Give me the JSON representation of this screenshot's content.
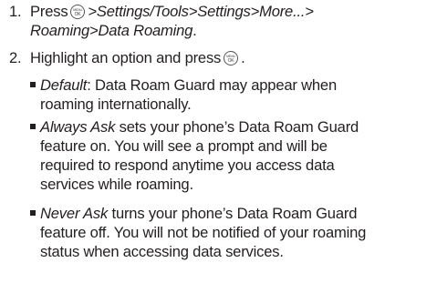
{
  "steps": [
    {
      "number": "1.",
      "prefix": "Press",
      "path_part1": ">Settings/Tools>Settings>More...>",
      "path_part2": "Roaming>Data Roaming",
      "suffix": "."
    },
    {
      "number": "2.",
      "text": "Highlight an option and press",
      "suffix": "."
    }
  ],
  "options": [
    {
      "name": "Default",
      "desc_line1": ": Data Roam Guard may appear when",
      "desc_line2": "roaming internationally."
    },
    {
      "name": "Always Ask",
      "desc_line1": " sets your phone’s Data Roam Guard",
      "desc_line2": "feature on. You will see a prompt and will be",
      "desc_line3": "required to respond anytime you access data",
      "desc_line4": "services while roaming."
    },
    {
      "name": "Never Ask",
      "desc_line1": " turns your phone’s Data Roam Guard",
      "desc_line2": "feature off. You will not be notified of your roaming",
      "desc_line3": "status when accessing data services."
    }
  ],
  "menu_key_icon": "menu-ok-key-icon"
}
